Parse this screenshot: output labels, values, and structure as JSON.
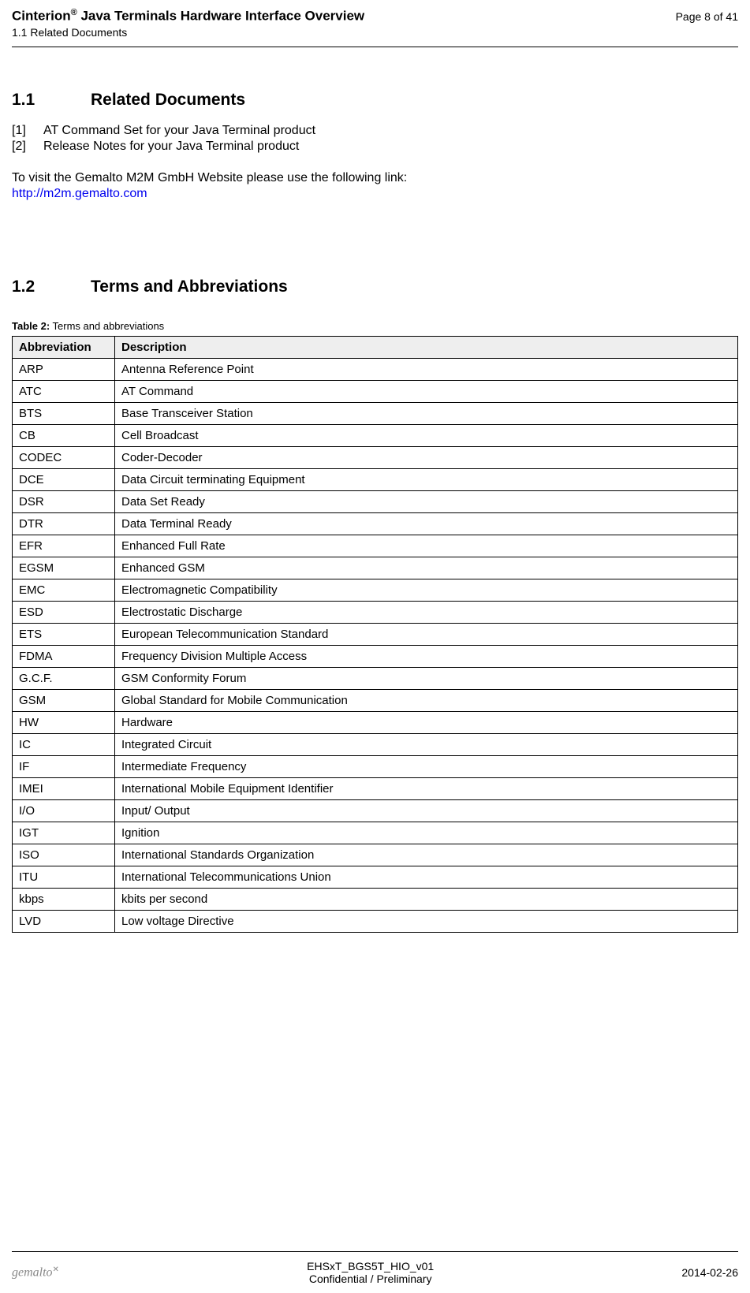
{
  "header": {
    "brand": "Cinterion",
    "title_rest": " Java Terminals Hardware Interface Overview",
    "subtitle": "1.1 Related Documents",
    "page": "Page 8 of 41"
  },
  "section1": {
    "num": "1.1",
    "title": "Related Documents",
    "refs": [
      {
        "bracket": "[1]",
        "text": "AT Command Set for your Java Terminal product"
      },
      {
        "bracket": "[2]",
        "text": "Release Notes for your Java Terminal product"
      }
    ],
    "body": "To visit the Gemalto M2M GmbH Website please use the following link:",
    "link": "http://m2m.gemalto.com"
  },
  "section2": {
    "num": "1.2",
    "title": "Terms and Abbreviations",
    "table_caption_label": "Table 2:",
    "table_caption_text": "  Terms and abbreviations",
    "col1": "Abbreviation",
    "col2": "Description",
    "rows": [
      {
        "abbr": "ARP",
        "desc": "Antenna Reference Point"
      },
      {
        "abbr": "ATC",
        "desc": "AT Command"
      },
      {
        "abbr": "BTS",
        "desc": "Base Transceiver Station"
      },
      {
        "abbr": "CB",
        "desc": "Cell Broadcast"
      },
      {
        "abbr": "CODEC",
        "desc": "Coder-Decoder"
      },
      {
        "abbr": "DCE",
        "desc": "Data Circuit terminating Equipment"
      },
      {
        "abbr": "DSR",
        "desc": "Data Set Ready"
      },
      {
        "abbr": "DTR",
        "desc": "Data Terminal Ready"
      },
      {
        "abbr": "EFR",
        "desc": "Enhanced Full Rate"
      },
      {
        "abbr": "EGSM",
        "desc": "Enhanced GSM"
      },
      {
        "abbr": "EMC",
        "desc": "Electromagnetic Compatibility"
      },
      {
        "abbr": "ESD",
        "desc": "Electrostatic Discharge"
      },
      {
        "abbr": "ETS",
        "desc": "European Telecommunication Standard"
      },
      {
        "abbr": "FDMA",
        "desc": "Frequency Division Multiple Access"
      },
      {
        "abbr": "G.C.F.",
        "desc": "GSM Conformity Forum"
      },
      {
        "abbr": "GSM",
        "desc": "Global Standard for Mobile Communication"
      },
      {
        "abbr": "HW",
        "desc": "Hardware"
      },
      {
        "abbr": "IC",
        "desc": "Integrated Circuit"
      },
      {
        "abbr": "IF",
        "desc": "Intermediate Frequency"
      },
      {
        "abbr": "IMEI",
        "desc": "International Mobile Equipment Identifier"
      },
      {
        "abbr": "I/O",
        "desc": "Input/ Output"
      },
      {
        "abbr": "IGT",
        "desc": "Ignition"
      },
      {
        "abbr": "ISO",
        "desc": "International Standards Organization"
      },
      {
        "abbr": "ITU",
        "desc": "International Telecommunications Union"
      },
      {
        "abbr": "kbps",
        "desc": "kbits per second"
      },
      {
        "abbr": "LVD",
        "desc": "Low voltage Directive"
      }
    ]
  },
  "footer": {
    "logo": "gemalto",
    "docid": "EHSxT_BGS5T_HIO_v01",
    "conf": "Confidential / Preliminary",
    "date": "2014-02-26"
  }
}
